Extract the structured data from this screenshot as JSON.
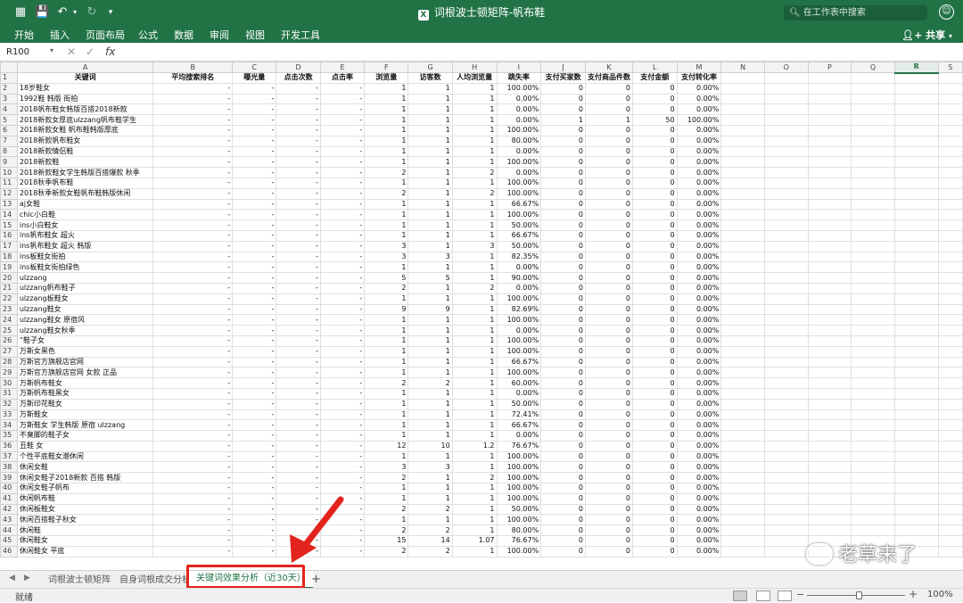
{
  "window": {
    "title": "词根波士顿矩阵-帆布鞋",
    "search_placeholder": "在工作表中搜索",
    "app_badge": "X"
  },
  "ribbon": {
    "tabs": [
      "开始",
      "插入",
      "页面布局",
      "公式",
      "数据",
      "审阅",
      "视图",
      "开发工具"
    ],
    "share": "共享"
  },
  "formula_bar": {
    "name_box": "R100",
    "fx": "fx",
    "cancel": "✕",
    "confirm": "✓"
  },
  "columns": [
    "",
    "A",
    "B",
    "C",
    "D",
    "E",
    "F",
    "G",
    "H",
    "I",
    "J",
    "K",
    "L",
    "M",
    "N",
    "O",
    "P",
    "Q",
    "R",
    "S"
  ],
  "selected_column": "R",
  "header_row": [
    "关键词",
    "平均搜索排名",
    "曝光量",
    "点击次数",
    "点击率",
    "浏览量",
    "访客数",
    "人均浏览量",
    "跳失率",
    "支付买家数",
    "支付商品件数",
    "支付金额",
    "支付转化率"
  ],
  "rows": [
    [
      "18岁鞋女",
      "-",
      "-",
      "-",
      "-",
      "1",
      "1",
      "1",
      "100.00%",
      "0",
      "0",
      "0",
      "0.00%"
    ],
    [
      "1992鞋 韩版 街拍",
      "-",
      "-",
      "-",
      "-",
      "1",
      "1",
      "1",
      "0.00%",
      "0",
      "0",
      "0",
      "0.00%"
    ],
    [
      "2018帆布鞋女韩版百搭2018新款",
      "-",
      "-",
      "-",
      "-",
      "1",
      "1",
      "1",
      "0.00%",
      "0",
      "0",
      "0",
      "0.00%"
    ],
    [
      "2018新款女厚底ulzzang帆布鞋学生",
      "-",
      "-",
      "-",
      "-",
      "1",
      "1",
      "1",
      "0.00%",
      "1",
      "1",
      "50",
      "100.00%"
    ],
    [
      "2018新款女鞋 帆布鞋韩版厚底",
      "-",
      "-",
      "-",
      "-",
      "1",
      "1",
      "1",
      "100.00%",
      "0",
      "0",
      "0",
      "0.00%"
    ],
    [
      "2018新款帆布鞋女",
      "-",
      "-",
      "-",
      "-",
      "1",
      "1",
      "1",
      "80.00%",
      "0",
      "0",
      "0",
      "0.00%"
    ],
    [
      "2018新款情侣鞋",
      "-",
      "-",
      "-",
      "-",
      "1",
      "1",
      "1",
      "0.00%",
      "0",
      "0",
      "0",
      "0.00%"
    ],
    [
      "2018新款鞋",
      "-",
      "-",
      "-",
      "-",
      "1",
      "1",
      "1",
      "100.00%",
      "0",
      "0",
      "0",
      "0.00%"
    ],
    [
      "2018新款鞋女学生韩版百搭爆款 秋季",
      "-",
      "-",
      "-",
      "-",
      "2",
      "1",
      "2",
      "0.00%",
      "0",
      "0",
      "0",
      "0.00%"
    ],
    [
      "2018秋季帆布鞋",
      "-",
      "-",
      "-",
      "-",
      "1",
      "1",
      "1",
      "100.00%",
      "0",
      "0",
      "0",
      "0.00%"
    ],
    [
      "2018秋季新款女鞋帆布鞋韩版休闲",
      "-",
      "-",
      "-",
      "-",
      "2",
      "1",
      "2",
      "100.00%",
      "0",
      "0",
      "0",
      "0.00%"
    ],
    [
      "aj女鞋",
      "-",
      "-",
      "-",
      "-",
      "1",
      "1",
      "1",
      "66.67%",
      "0",
      "0",
      "0",
      "0.00%"
    ],
    [
      "chic小白鞋",
      "-",
      "-",
      "-",
      "-",
      "1",
      "1",
      "1",
      "100.00%",
      "0",
      "0",
      "0",
      "0.00%"
    ],
    [
      "ins小白鞋女",
      "-",
      "-",
      "-",
      "-",
      "1",
      "1",
      "1",
      "50.00%",
      "0",
      "0",
      "0",
      "0.00%"
    ],
    [
      "ins帆布鞋女 超火",
      "-",
      "-",
      "-",
      "-",
      "1",
      "1",
      "1",
      "66.67%",
      "0",
      "0",
      "0",
      "0.00%"
    ],
    [
      "ins帆布鞋女 超火 韩版",
      "-",
      "-",
      "-",
      "-",
      "3",
      "1",
      "3",
      "50.00%",
      "0",
      "0",
      "0",
      "0.00%"
    ],
    [
      "ins板鞋女街拍",
      "-",
      "-",
      "-",
      "-",
      "3",
      "3",
      "1",
      "82.35%",
      "0",
      "0",
      "0",
      "0.00%"
    ],
    [
      "ins板鞋女街拍绿色",
      "-",
      "-",
      "-",
      "-",
      "1",
      "1",
      "1",
      "0.00%",
      "0",
      "0",
      "0",
      "0.00%"
    ],
    [
      "ulzzang",
      "-",
      "-",
      "-",
      "-",
      "5",
      "5",
      "1",
      "90.00%",
      "0",
      "0",
      "0",
      "0.00%"
    ],
    [
      "ulzzang帆布鞋子",
      "-",
      "-",
      "-",
      "-",
      "2",
      "1",
      "2",
      "0.00%",
      "0",
      "0",
      "0",
      "0.00%"
    ],
    [
      "ulzzang板鞋女",
      "-",
      "-",
      "-",
      "-",
      "1",
      "1",
      "1",
      "100.00%",
      "0",
      "0",
      "0",
      "0.00%"
    ],
    [
      "ulzzang鞋女",
      "-",
      "-",
      "-",
      "-",
      "9",
      "9",
      "1",
      "82.69%",
      "0",
      "0",
      "0",
      "0.00%"
    ],
    [
      "ulzzang鞋女 原宿风",
      "-",
      "-",
      "-",
      "-",
      "1",
      "1",
      "1",
      "100.00%",
      "0",
      "0",
      "0",
      "0.00%"
    ],
    [
      "ulzzang鞋女秋季",
      "-",
      "-",
      "-",
      "-",
      "1",
      "1",
      "1",
      "0.00%",
      "0",
      "0",
      "0",
      "0.00%"
    ],
    [
      "“鞋子女",
      "-",
      "-",
      "-",
      "-",
      "1",
      "1",
      "1",
      "100.00%",
      "0",
      "0",
      "0",
      "0.00%"
    ],
    [
      "万斯女黑色",
      "-",
      "-",
      "-",
      "-",
      "1",
      "1",
      "1",
      "100.00%",
      "0",
      "0",
      "0",
      "0.00%"
    ],
    [
      "万斯官方旗舰店官网",
      "-",
      "-",
      "-",
      "-",
      "1",
      "1",
      "1",
      "66.67%",
      "0",
      "0",
      "0",
      "0.00%"
    ],
    [
      "万斯官方旗舰店官网 女款 正品",
      "-",
      "-",
      "-",
      "-",
      "1",
      "1",
      "1",
      "100.00%",
      "0",
      "0",
      "0",
      "0.00%"
    ],
    [
      "万斯帆布鞋女",
      "-",
      "-",
      "-",
      "-",
      "2",
      "2",
      "1",
      "60.00%",
      "0",
      "0",
      "0",
      "0.00%"
    ],
    [
      "万斯帆布鞋黑女",
      "-",
      "-",
      "-",
      "-",
      "1",
      "1",
      "1",
      "0.00%",
      "0",
      "0",
      "0",
      "0.00%"
    ],
    [
      "万斯印花鞋女",
      "-",
      "-",
      "-",
      "-",
      "1",
      "1",
      "1",
      "50.00%",
      "0",
      "0",
      "0",
      "0.00%"
    ],
    [
      "万斯鞋女",
      "-",
      "-",
      "-",
      "-",
      "1",
      "1",
      "1",
      "72.41%",
      "0",
      "0",
      "0",
      "0.00%"
    ],
    [
      "万斯鞋女 学生韩版 原宿 ulzzang",
      "-",
      "-",
      "-",
      "-",
      "1",
      "1",
      "1",
      "66.67%",
      "0",
      "0",
      "0",
      "0.00%"
    ],
    [
      "不臭脚的鞋子女",
      "-",
      "-",
      "-",
      "-",
      "1",
      "1",
      "1",
      "0.00%",
      "0",
      "0",
      "0",
      "0.00%"
    ],
    [
      "丑鞋 女",
      "-",
      "-",
      "-",
      "-",
      "12",
      "10",
      "1.2",
      "76.67%",
      "0",
      "0",
      "0",
      "0.00%"
    ],
    [
      "个性平底鞋女潮休闲",
      "-",
      "-",
      "-",
      "-",
      "1",
      "1",
      "1",
      "100.00%",
      "0",
      "0",
      "0",
      "0.00%"
    ],
    [
      "休闲女鞋",
      "-",
      "-",
      "-",
      "-",
      "3",
      "3",
      "1",
      "100.00%",
      "0",
      "0",
      "0",
      "0.00%"
    ],
    [
      "休闲女鞋子2018新款 百搭 韩版",
      "-",
      "-",
      "-",
      "-",
      "2",
      "1",
      "2",
      "100.00%",
      "0",
      "0",
      "0",
      "0.00%"
    ],
    [
      "休闲女鞋子帆布",
      "-",
      "-",
      "-",
      "-",
      "1",
      "1",
      "1",
      "100.00%",
      "0",
      "0",
      "0",
      "0.00%"
    ],
    [
      "休闲帆布鞋",
      "-",
      "-",
      "-",
      "-",
      "1",
      "1",
      "1",
      "100.00%",
      "0",
      "0",
      "0",
      "0.00%"
    ],
    [
      "休闲板鞋女",
      "-",
      "-",
      "-",
      "-",
      "2",
      "2",
      "1",
      "50.00%",
      "0",
      "0",
      "0",
      "0.00%"
    ],
    [
      "休闲百搭鞋子秋女",
      "-",
      "-",
      "-",
      "-",
      "1",
      "1",
      "1",
      "100.00%",
      "0",
      "0",
      "0",
      "0.00%"
    ],
    [
      "休闲鞋",
      "-",
      "-",
      "-",
      "-",
      "2",
      "2",
      "1",
      "80.00%",
      "0",
      "0",
      "0",
      "0.00%"
    ],
    [
      "休闲鞋女",
      "-",
      "-",
      "-",
      "-",
      "15",
      "14",
      "1.07",
      "76.67%",
      "0",
      "0",
      "0",
      "0.00%"
    ],
    [
      "休闲鞋女 平底",
      "-",
      "-",
      "-",
      "-",
      "2",
      "2",
      "1",
      "100.00%",
      "0",
      "0",
      "0",
      "0.00%"
    ]
  ],
  "sheet_tabs": [
    "词根波士顿矩阵",
    "自身词根成交分析",
    "关键词效果分析（近30天）"
  ],
  "active_sheet_index": 2,
  "status": {
    "ready": "就绪",
    "zoom": "100%",
    "zoom_level": 1.0
  },
  "watermark": "老草来了",
  "colors": {
    "excel_green": "#217346",
    "highlight_red": "#e3231d"
  }
}
